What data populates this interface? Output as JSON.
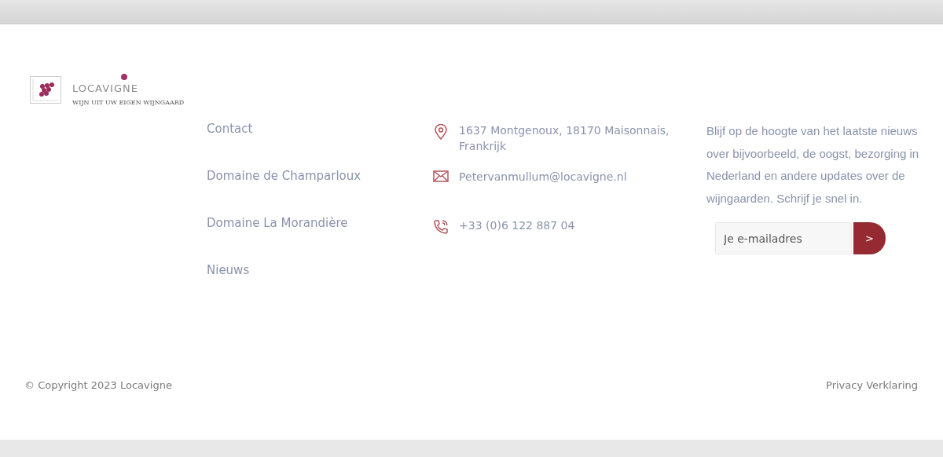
{
  "logo": {
    "name": "LOCAVIGNE",
    "tagline": "WIJN UIT UW EIGEN WIJNGAARD"
  },
  "links": [
    "Contact",
    "Domaine de Champarloux",
    "Domaine La Morandière",
    "Nieuws"
  ],
  "contact": [
    {
      "kind": "address",
      "text": "1637 Montgenoux, 18170 Maisonnais, Frankrijk"
    },
    {
      "kind": "email",
      "text": "Petervanmullum@locavigne.nl"
    },
    {
      "kind": "phone",
      "text": "+33 (0)6 122 887 04"
    }
  ],
  "newsletter": {
    "text": "Blijf op de hoogte van het laatste nieuws over bijvoorbeeld, de oogst, bezorging in Nederland en andere updates over de wijngaarden. Schrijf je snel in.",
    "placeholder": "Je e-mailadres",
    "button": ">"
  },
  "footer": {
    "copyright": "© Copyright 2023 Locavigne",
    "privacy": "Privacy Verklaring"
  }
}
